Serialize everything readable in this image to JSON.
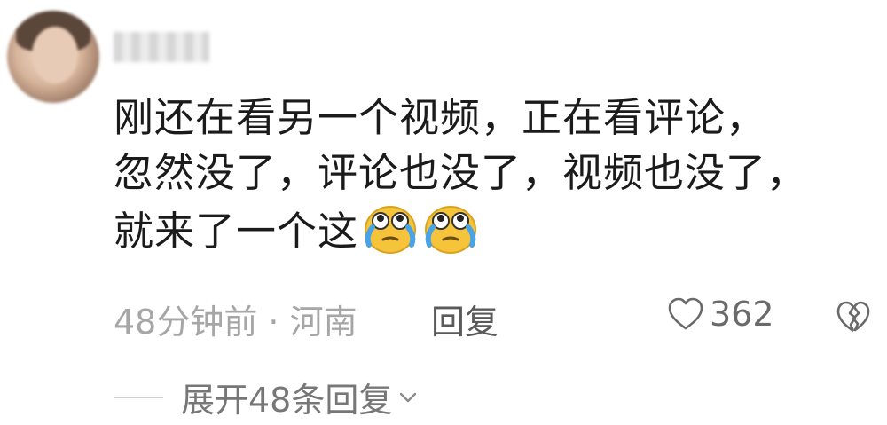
{
  "comment": {
    "lines": [
      "刚还在看另一个视频，正在看评论，",
      "忽然没了，评论也没了，视频也没了，",
      "就来了一个这"
    ],
    "emoji": [
      "crying-face-emoji",
      "crying-face-emoji"
    ]
  },
  "meta": {
    "time_location": "48分钟前 · 河南",
    "reply_label": "回复",
    "like_count": "362"
  },
  "expand": {
    "label": "展开48条回复"
  },
  "icons": {
    "like": "heart-outline-icon",
    "dislike": "broken-heart-icon",
    "expand": "chevron-down-icon"
  },
  "colors": {
    "text": "#1b1b1b",
    "meta": "#a6a6a6",
    "emoji_yellow": "#f6c43a",
    "tears": "#4aa3e6"
  }
}
